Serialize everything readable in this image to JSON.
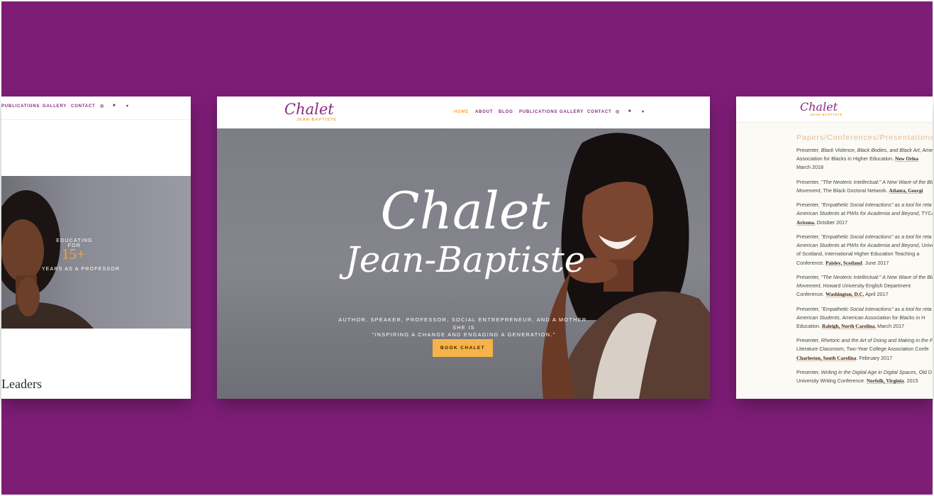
{
  "colors": {
    "background": "#7d1d76",
    "brand_purple": "#8a2a80",
    "accent_orange": "#f6a53b",
    "button": "#f6b34a"
  },
  "left_card": {
    "nav": [
      "PUBLICATIONS",
      "GALLERY",
      "CONTACT"
    ],
    "social_icons": [
      "instagram-icon",
      "facebook-icon",
      "twitter-icon"
    ],
    "educating_for": "EDUCATING FOR",
    "years_number": "15+",
    "years_text": "YEARS AS A PROFESSOR",
    "heading": "Leaders"
  },
  "center_card": {
    "logo_script": "Chalet",
    "logo_sub": "JEAN-BAPTISTE",
    "nav": [
      "HOME",
      "ABOUT",
      "BLOG",
      "PUBLICATIONS",
      "GALLERY",
      "CONTACT"
    ],
    "social_icons": [
      "instagram-icon",
      "facebook-icon",
      "twitter-icon"
    ],
    "hero_title_1": "Chalet",
    "hero_title_2": "Jean-Baptiste",
    "hero_sub_1": "AUTHOR, SPEAKER, PROFESSOR, SOCIAL ENTREPRENEUR, AND A MOTHER. SHE IS",
    "hero_sub_2": "\"INSPIRING A CHANGE AND ENGAGING A GENERATION.\"",
    "cta": "BOOK CHALET"
  },
  "right_card": {
    "logo_script": "Chalet",
    "logo_sub": "JEAN-BAPTISTE",
    "section_title": "Papers/Conferences/Presentations",
    "entries": [
      {
        "l1a": "Presenter, ",
        "l1i": "Black Violence, Black Bodies, and Black Art",
        "l1b": ", Amer",
        "l2a": "Association for Blacks in Higher Education. ",
        "l2loc": "New Orlea",
        "l2b": "",
        "l3": "March 2018"
      },
      {
        "l1a": "Presenter, ",
        "l1i": "\"The Neoteric Intellectual:\" A New Wave of the Bla",
        "l1b": "",
        "l2a": "",
        "l2i": "Movement",
        "l2b": ", The Black Doctoral Network. ",
        "l2loc": "Atlanta, Georgi",
        "l3": ""
      },
      {
        "l1a": "Presenter, ",
        "l1i": "\"Empathetic Social Interactions\" as a tool for reta",
        "l1b": "",
        "l2a": "",
        "l2i": "American Students at PWIs for Academia and Beyond",
        "l2b": ", TYCA-",
        "l2loc": "",
        "l3loc": "Arizona.",
        "l3": " October 2017"
      },
      {
        "l1a": "Presenter, ",
        "l1i": "\"Empathetic Social Interactions\" as a tool for reta",
        "l1b": "",
        "l2a": "",
        "l2i": "American Students at PWIs for Academia and Beyond",
        "l2b": ", Unive",
        "l2loc": "",
        "l3": "of Scotland, International Higher Education Teaching a",
        "l4a": "Conference. ",
        "l4loc": "Paisley, Scotland",
        "l4b": ". June 2017"
      },
      {
        "l1a": "Presenter, ",
        "l1i": "\"The Neoteric Intellectual:\" A New Wave of the Bla",
        "l1b": "",
        "l2a": "",
        "l2i": "Movement",
        "l2b": ", Howard University English Department",
        "l2loc": "",
        "l3": "Conference. ",
        "l3loc": "Washington, D.C.",
        "l3b": " April 2017"
      },
      {
        "l1a": "Presenter, ",
        "l1i": "\"Empathetic Social Interactions\" as a tool for reta",
        "l1b": "",
        "l2a": "",
        "l2i": "American Students",
        "l2b": ", American Association for Blacks in H",
        "l2loc": "",
        "l3": "Education. ",
        "l3loc": "Raleigh, North Carolina.",
        "l3b": " March 2017"
      },
      {
        "l1a": "Presenter, ",
        "l1i": "Rhetoric and the Art of Doing and Making in the F",
        "l1b": "",
        "l2a": "Literature Classroom, Two-Year College Association Confe",
        "l2loc": "",
        "l2b": "",
        "l3": "",
        "l3loc": "Charleston, South Carolina",
        "l3b": ". February 2017"
      },
      {
        "l1a": "Presenter, ",
        "l1i": "Writing in the Digital Age in Digital Spaces",
        "l1b": ", Old D",
        "l2a": "University Writing Conference. ",
        "l2loc": "Norfolk, Virginia",
        "l2b": ". 2015"
      }
    ]
  }
}
